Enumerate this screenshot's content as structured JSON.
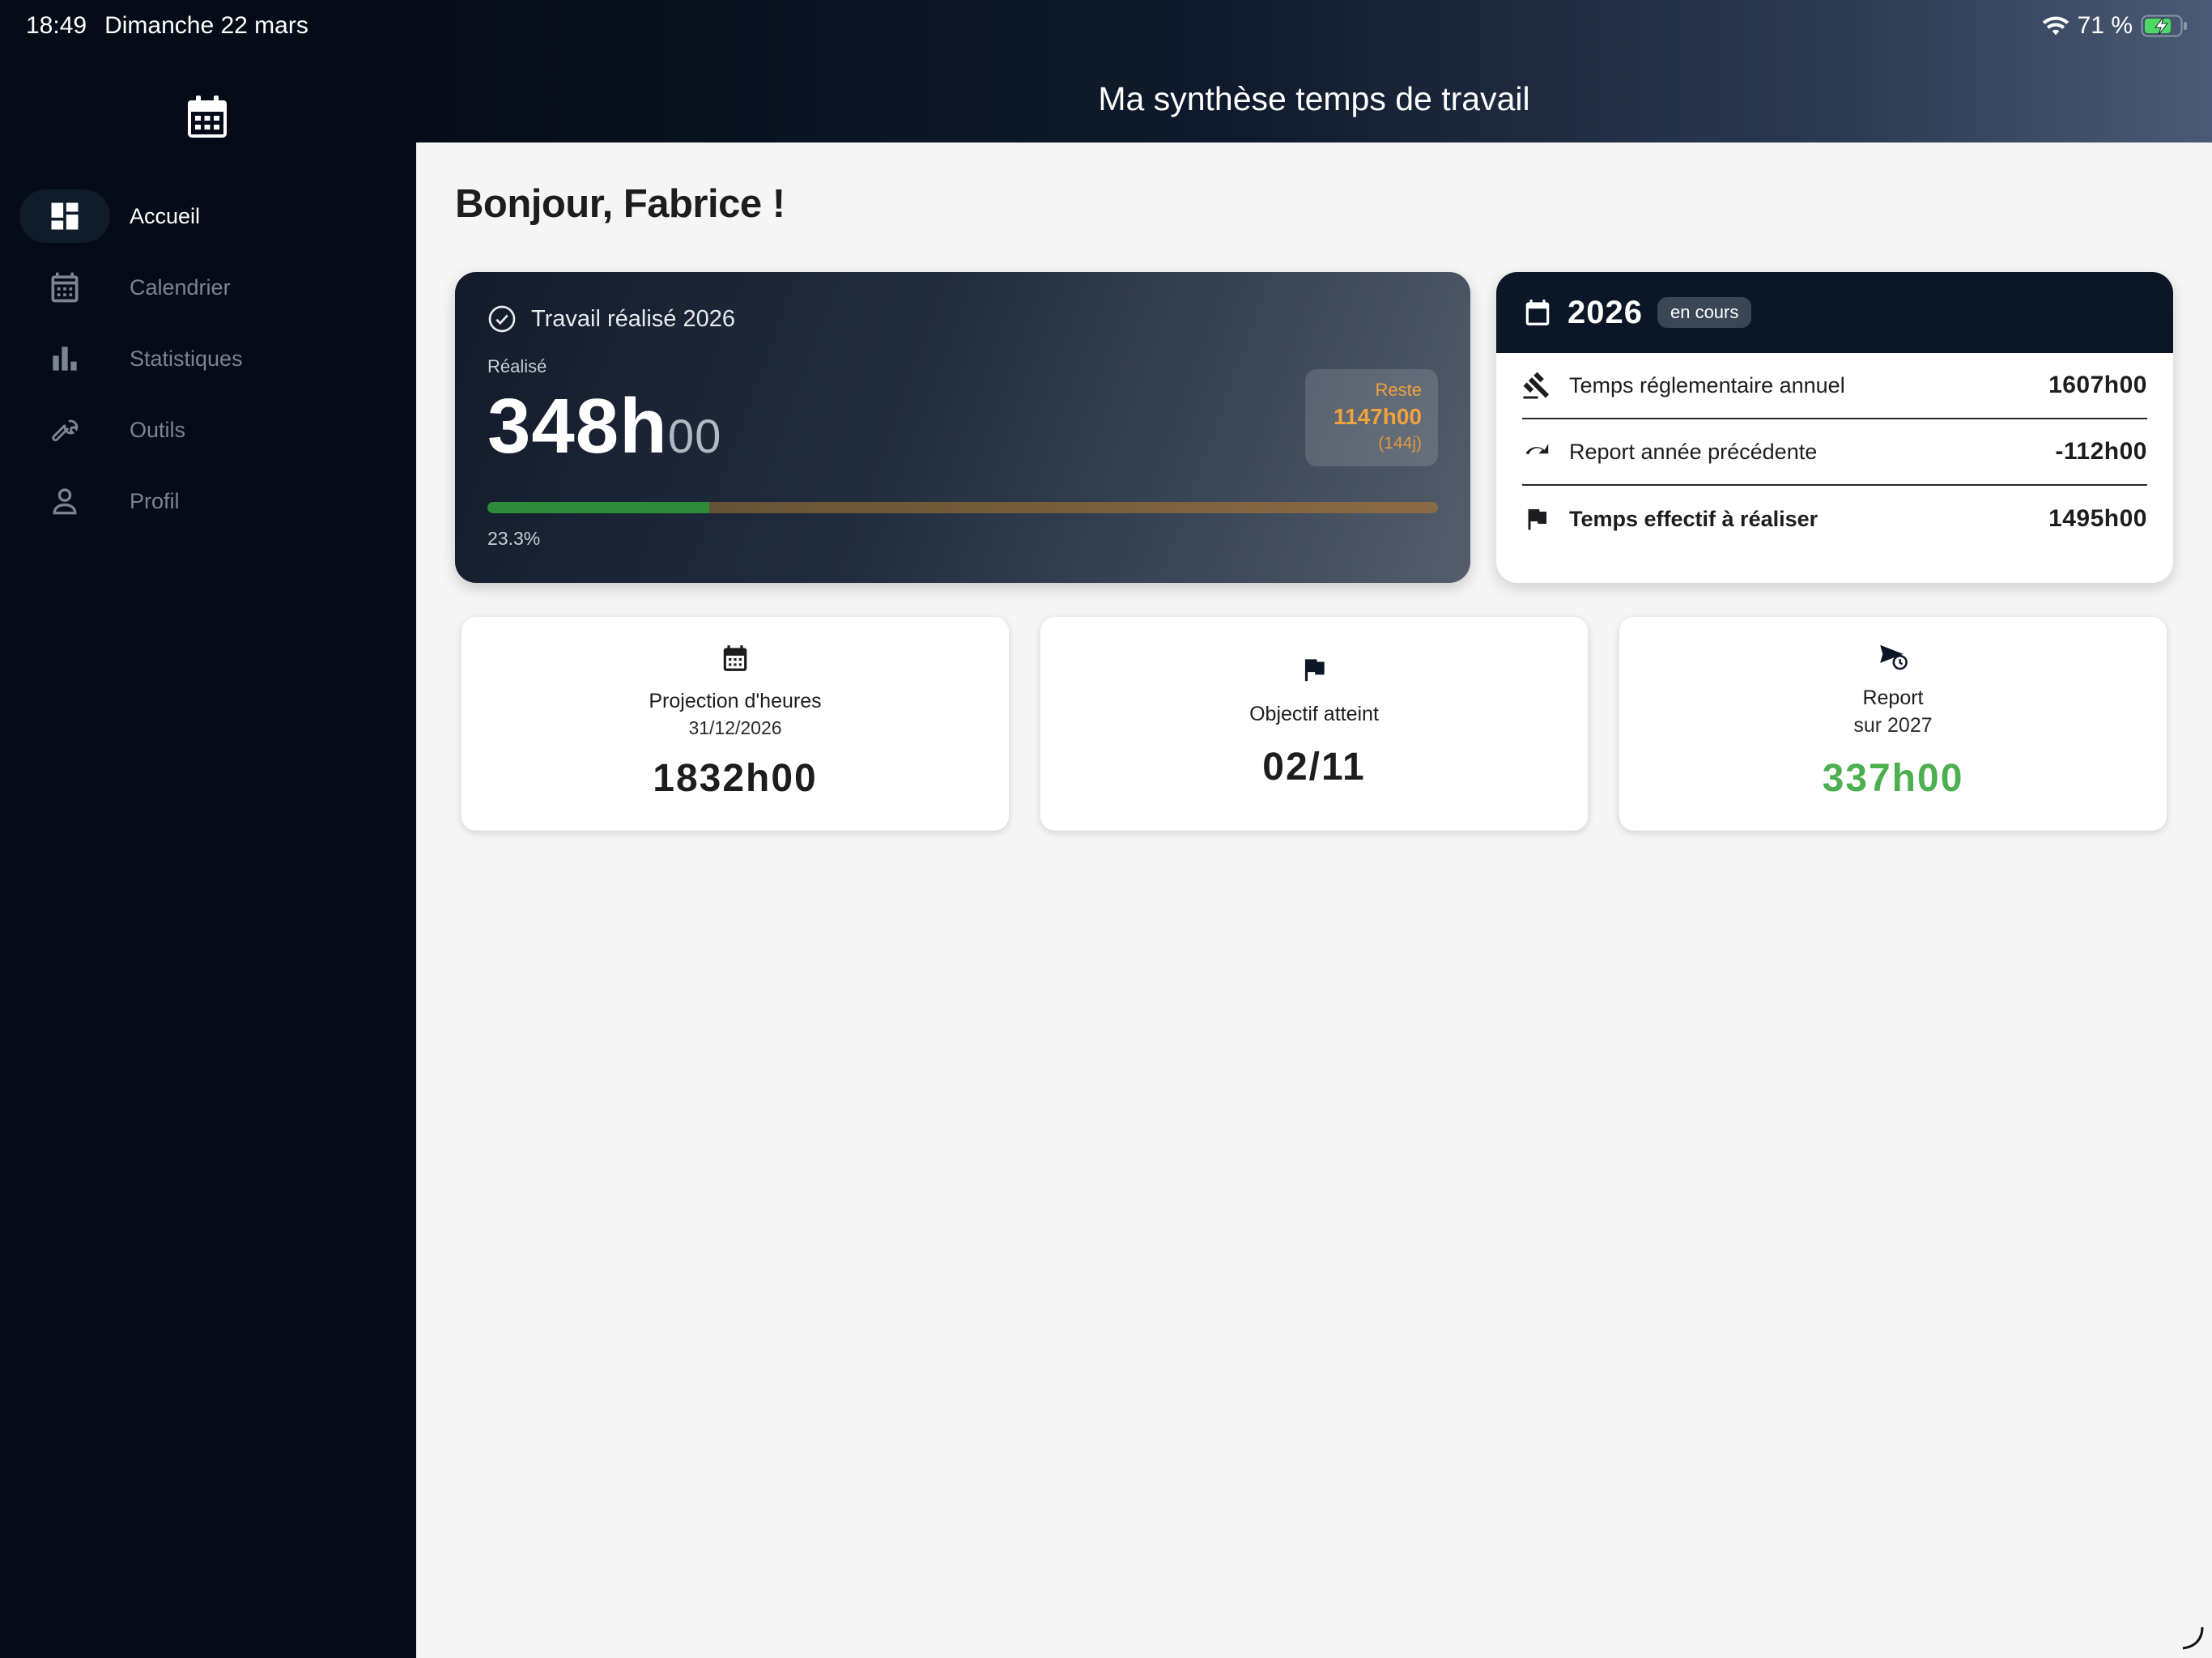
{
  "status_bar": {
    "time": "18:49",
    "date": "Dimanche 22 mars",
    "battery": "71 %"
  },
  "sidebar": {
    "items": [
      {
        "label": "Accueil",
        "icon": "dashboard-icon",
        "active": true
      },
      {
        "label": "Calendrier",
        "icon": "calendar-icon",
        "active": false
      },
      {
        "label": "Statistiques",
        "icon": "bar-chart-icon",
        "active": false
      },
      {
        "label": "Outils",
        "icon": "wrench-icon",
        "active": false
      },
      {
        "label": "Profil",
        "icon": "person-icon",
        "active": false
      }
    ]
  },
  "header": {
    "title": "Ma synthèse temps de travail"
  },
  "greeting": "Bonjour, Fabrice !",
  "work_card": {
    "title": "Travail réalisé 2026",
    "label": "Réalisé",
    "hours": "348h",
    "minutes": "00",
    "reste_label": "Reste",
    "reste_value": "1147h00",
    "reste_days": "(144j)",
    "progress_percent": 23.3,
    "progress_text": "23.3%"
  },
  "year_card": {
    "year": "2026",
    "badge": "en cours",
    "rows": [
      {
        "label": "Temps réglementaire annuel",
        "value": "1607h00",
        "icon": "gavel-icon"
      },
      {
        "label": "Report année précédente",
        "value": "-112h00",
        "icon": "redo-icon"
      },
      {
        "label": "Temps effectif à réaliser",
        "value": "1495h00",
        "icon": "flag-icon"
      }
    ]
  },
  "stats": {
    "projection": {
      "label": "Projection d'heures",
      "sub": "31/12/2026",
      "value": "1832h00"
    },
    "objectif": {
      "label": "Objectif atteint",
      "value": "02/11"
    },
    "report": {
      "label": "Report",
      "sub": "sur 2027",
      "value": "337h00"
    }
  },
  "colors": {
    "sidebar_bg": "#050c17",
    "accent_orange": "#f0a23c",
    "progress_green": "#2e8b3a",
    "positive_green": "#4caf50"
  }
}
